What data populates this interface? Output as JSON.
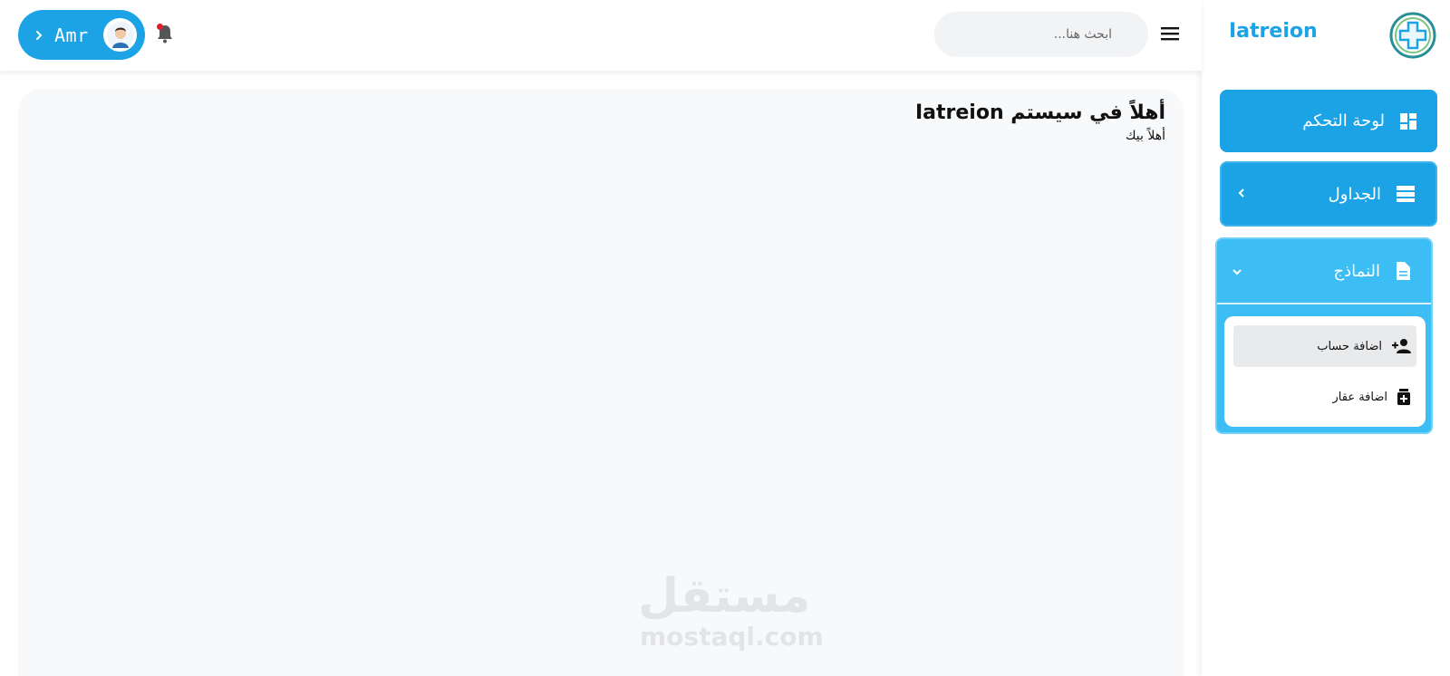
{
  "header": {
    "user_name": "Amr",
    "search_placeholder": "ابحث هنا...",
    "icons": [
      "chevron-right-icon",
      "avatar",
      "bell-icon",
      "hamburger-icon"
    ]
  },
  "main": {
    "title": "أهلاً في سيستم Iatreion",
    "subtitle": "أهلاً بيك",
    "watermark_ar": "مستقل",
    "watermark_en": "mostaql.com"
  },
  "sidebar": {
    "brand": "Iatreion",
    "items": [
      {
        "label": "لوحة التحكم",
        "icon": "dashboard-icon"
      },
      {
        "label": "الجداول",
        "icon": "table-icon"
      },
      {
        "label": "النماذج",
        "icon": "document-icon"
      }
    ],
    "sub_items": [
      {
        "label": "اضافة حساب",
        "icon": "person-add-icon"
      },
      {
        "label": "اضافة عقار",
        "icon": "medicine-bottle-icon"
      }
    ],
    "colors": {
      "primary": "#1ba3e6",
      "active": "#3cbdf4"
    }
  }
}
